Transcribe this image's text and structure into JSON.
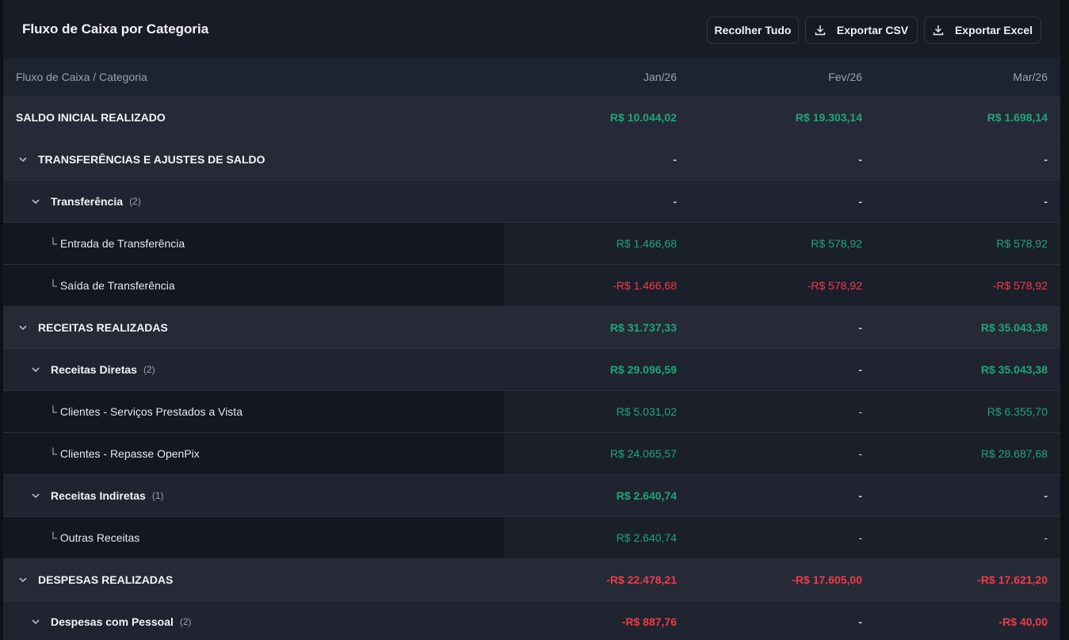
{
  "title": "Fluxo de Caixa por Categoria",
  "buttons": {
    "collapse": "Recolher Tudo",
    "csv": "Exportar CSV",
    "excel": "Exportar Excel"
  },
  "columns": {
    "label": "Fluxo de Caixa / Categoria",
    "months": [
      "Jan/26",
      "Fev/26",
      "Mar/26"
    ]
  },
  "rows": [
    {
      "label": "SALDO INICIAL REALIZADO",
      "values": [
        "R$ 10.044,02",
        "R$ 19.303,14",
        "R$ 1.698,14"
      ]
    },
    {
      "label": "TRANSFERÊNCIAS E AJUSTES DE SALDO",
      "values": [
        "-",
        "-",
        "-"
      ]
    },
    {
      "label": "Transferência",
      "count": "(2)",
      "values": [
        "-",
        "-",
        "-"
      ]
    },
    {
      "label": "Entrada de Transferência",
      "values": [
        "R$ 1.466,68",
        "R$ 578,92",
        "R$ 578,92"
      ]
    },
    {
      "label": "Saída de Transferência",
      "values": [
        "-R$ 1.466,68",
        "-R$ 578,92",
        "-R$ 578,92"
      ]
    },
    {
      "label": "RECEITAS REALIZADAS",
      "values": [
        "R$ 31.737,33",
        "-",
        "R$ 35.043,38"
      ]
    },
    {
      "label": "Receitas Diretas",
      "count": "(2)",
      "values": [
        "R$ 29.096,59",
        "-",
        "R$ 35.043,38"
      ]
    },
    {
      "label": "Clientes - Serviços Prestados a Vista",
      "values": [
        "R$ 5.031,02",
        "-",
        "R$ 6.355,70"
      ]
    },
    {
      "label": "Clientes - Repasse OpenPix",
      "values": [
        "R$ 24.065,57",
        "-",
        "R$ 28.687,68"
      ]
    },
    {
      "label": "Receitas Indiretas",
      "count": "(1)",
      "values": [
        "R$ 2.640,74",
        "-",
        "-"
      ]
    },
    {
      "label": "Outras Receitas",
      "values": [
        "R$ 2.640,74",
        "-",
        "-"
      ]
    },
    {
      "label": "DESPESAS REALIZADAS",
      "values": [
        "-R$ 22.478,21",
        "-R$ 17.605,00",
        "-R$ 17.621,20"
      ]
    },
    {
      "label": "Despesas com Pessoal",
      "count": "(2)",
      "values": [
        "-R$ 887,76",
        "-",
        "-R$ 40,00"
      ]
    }
  ],
  "colors": {
    "positive": "#1ea67a",
    "negative": "#f03a4a"
  }
}
